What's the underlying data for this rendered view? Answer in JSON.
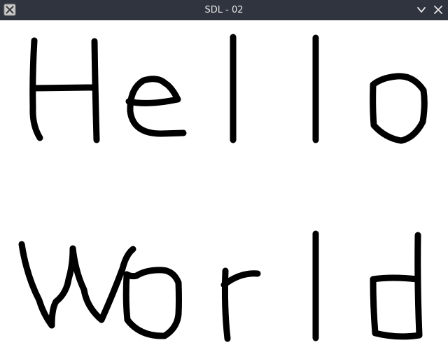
{
  "window": {
    "title": "SDL - 02"
  },
  "icons": {
    "app": "x-window-icon",
    "minimize": "chevron-down-icon",
    "close": "close-icon"
  },
  "colors": {
    "titlebar": "#2f343f",
    "title_text": "#e6e6e6",
    "canvas": "#ffffff",
    "ink": "#000000"
  }
}
